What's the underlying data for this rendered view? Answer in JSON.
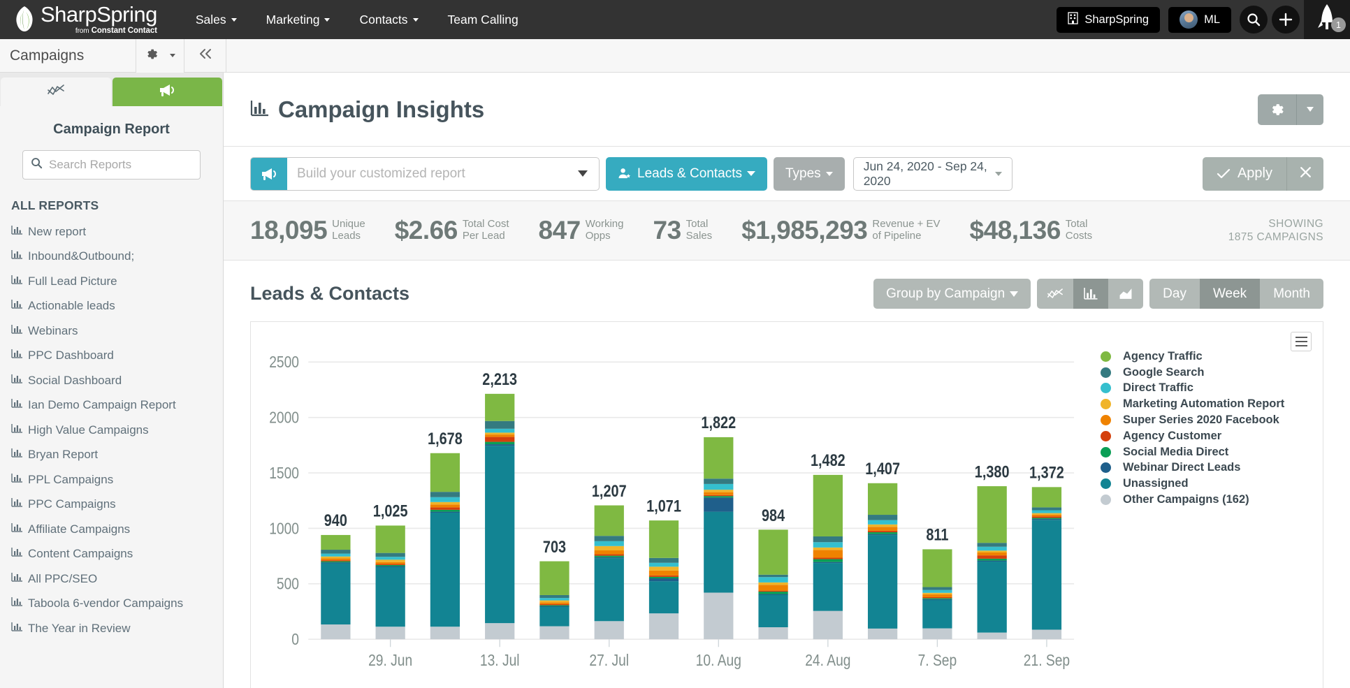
{
  "topnav": {
    "brand": {
      "name": "SharpSpring",
      "sub_from": "from",
      "sub_company": "Constant Contact",
      "icon": "leaf-logo-icon"
    },
    "items": [
      {
        "label": "Sales",
        "has_caret": true
      },
      {
        "label": "Marketing",
        "has_caret": true
      },
      {
        "label": "Contacts",
        "has_caret": true
      },
      {
        "label": "Team Calling",
        "has_caret": false
      }
    ],
    "company_pill": {
      "label": "SharpSpring",
      "icon": "building-icon"
    },
    "user_pill": {
      "label": "ML",
      "icon": "avatar"
    },
    "search_icon": "search-icon",
    "add_icon": "plus-icon",
    "rocket_icon": "rocket-icon",
    "rocket_badge": "1"
  },
  "subheader": {
    "title": "Campaigns",
    "gear_icon": "gear-icon",
    "collapse_icon": "double-chevron-left-icon"
  },
  "sidebar": {
    "tab_trend_icon": "trend-line-icon",
    "tab_campaign_icon": "megaphone-icon",
    "heading": "Campaign Report",
    "search_placeholder": "Search Reports",
    "search_value": "",
    "section_label": "ALL REPORTS",
    "items": [
      {
        "label": "New report"
      },
      {
        "label": "Inbound&Outbound;"
      },
      {
        "label": "Full Lead Picture"
      },
      {
        "label": "Actionable leads"
      },
      {
        "label": "Webinars"
      },
      {
        "label": "PPC Dashboard"
      },
      {
        "label": "Social Dashboard"
      },
      {
        "label": "Ian Demo Campaign Report"
      },
      {
        "label": "High Value Campaigns"
      },
      {
        "label": "Bryan Report"
      },
      {
        "label": "PPL Campaigns"
      },
      {
        "label": "PPC Campaigns"
      },
      {
        "label": "Affiliate Campaigns"
      },
      {
        "label": "Content Campaigns"
      },
      {
        "label": "All PPC/SEO"
      },
      {
        "label": "Taboola 6-vendor Campaigns"
      },
      {
        "label": "The Year in Review"
      }
    ]
  },
  "main": {
    "page_title": "Campaign Insights",
    "page_title_icon": "bar-chart-icon",
    "settings_gear_icon": "gear-icon",
    "settings_caret_icon": "caret-down-icon"
  },
  "filters": {
    "report_icon": "megaphone-icon",
    "report_placeholder": "Build your customized report",
    "report_value": "",
    "leads_contacts_label": "Leads & Contacts",
    "leads_contacts_icon": "user-star-icon",
    "types_label": "Types",
    "date_range": "Jun 24, 2020 - Sep 24, 2020",
    "apply_label": "Apply",
    "apply_icon": "check-icon",
    "clear_icon": "close-icon"
  },
  "kpis": [
    {
      "value": "18,095",
      "label": "Unique\nLeads"
    },
    {
      "value": "$2.66",
      "label": "Total Cost\nPer Lead"
    },
    {
      "value": "847",
      "label": "Working\nOpps"
    },
    {
      "value": "73",
      "label": "Total\nSales"
    },
    {
      "value": "$1,985,293",
      "label": "Revenue + EV\nof Pipeline"
    },
    {
      "value": "$48,136",
      "label": "Total\nCosts"
    }
  ],
  "showing": {
    "line1": "SHOWING",
    "line2": "1875 CAMPAIGNS"
  },
  "chart_controls": {
    "group_by_label": "Group by Campaign",
    "group_by_caret": "caret-down-icon",
    "view_line_icon": "line-chart-icon",
    "view_bar_icon": "bar-chart-icon",
    "view_area_icon": "area-chart-icon",
    "view_selected": "bar",
    "granularity": [
      "Day",
      "Week",
      "Month"
    ],
    "granularity_selected": "Week",
    "menu_icon": "hamburger-menu-icon"
  },
  "chart_data": {
    "type": "bar",
    "stacked": true,
    "title": "Leads & Contacts",
    "xlabel": "",
    "ylabel": "",
    "ylim": [
      0,
      2500
    ],
    "yticks": [
      0,
      500,
      1000,
      1500,
      2000,
      2500
    ],
    "grid": true,
    "legend_position": "right",
    "x_tick_labels": [
      "29. Jun",
      "13. Jul",
      "27. Jul",
      "10. Aug",
      "24. Aug",
      "7. Sep",
      "21. Sep"
    ],
    "x_tick_indices": [
      1,
      3,
      5,
      7,
      9,
      11,
      13
    ],
    "categories": [
      "",
      "29. Jun",
      "",
      "13. Jul",
      "",
      "27. Jul",
      "",
      "10. Aug",
      "",
      "24. Aug",
      "",
      "7. Sep",
      "",
      "21. Sep"
    ],
    "totals": [
      940,
      1025,
      1678,
      2213,
      703,
      1207,
      1071,
      1822,
      984,
      1482,
      1407,
      811,
      1380,
      1372
    ],
    "series": [
      {
        "name": "Other Campaigns (162)",
        "color": "#c3cbd1",
        "values": [
          133,
          113,
          113,
          145,
          117,
          163,
          233,
          420,
          108,
          255,
          96,
          98,
          60,
          86
        ]
      },
      {
        "name": "Unassigned",
        "color": "#128493",
        "values": [
          554,
          540,
          1028,
          1600,
          178,
          568,
          290,
          730,
          293,
          432,
          843,
          258,
          640,
          990
        ]
      },
      {
        "name": "Webinar Direct Leads",
        "color": "#1f5f8b",
        "values": [
          6,
          6,
          9,
          13,
          5,
          9,
          26,
          128,
          6,
          9,
          9,
          5,
          9,
          9
        ]
      },
      {
        "name": "Social Media Direct",
        "color": "#0a9e55",
        "values": [
          10,
          10,
          17,
          22,
          7,
          13,
          13,
          13,
          22,
          26,
          17,
          9,
          17,
          9
        ]
      },
      {
        "name": "Agency Customer",
        "color": "#d4400c",
        "values": [
          9,
          9,
          22,
          44,
          9,
          13,
          13,
          9,
          9,
          13,
          13,
          9,
          30,
          13
        ]
      },
      {
        "name": "Super Series 2020 Facebook",
        "color": "#ef8200",
        "values": [
          17,
          17,
          26,
          22,
          17,
          35,
          44,
          26,
          52,
          70,
          35,
          26,
          26,
          17
        ]
      },
      {
        "name": "Marketing Automation Report",
        "color": "#f0b429",
        "values": [
          17,
          22,
          22,
          17,
          17,
          39,
          35,
          22,
          22,
          22,
          22,
          13,
          17,
          13
        ]
      },
      {
        "name": "Direct Traffic",
        "color": "#35bfce",
        "values": [
          26,
          26,
          44,
          35,
          22,
          44,
          35,
          52,
          48,
          48,
          39,
          26,
          35,
          26
        ]
      },
      {
        "name": "Google Search",
        "color": "#347a80",
        "values": [
          35,
          35,
          48,
          70,
          26,
          48,
          44,
          48,
          22,
          52,
          48,
          26,
          35,
          26
        ]
      },
      {
        "name": "Agency Traffic",
        "color": "#7fb942",
        "values": [
          133,
          247,
          349,
          245,
          305,
          275,
          338,
          374,
          406,
          555,
          285,
          341,
          511,
          183
        ]
      }
    ]
  }
}
